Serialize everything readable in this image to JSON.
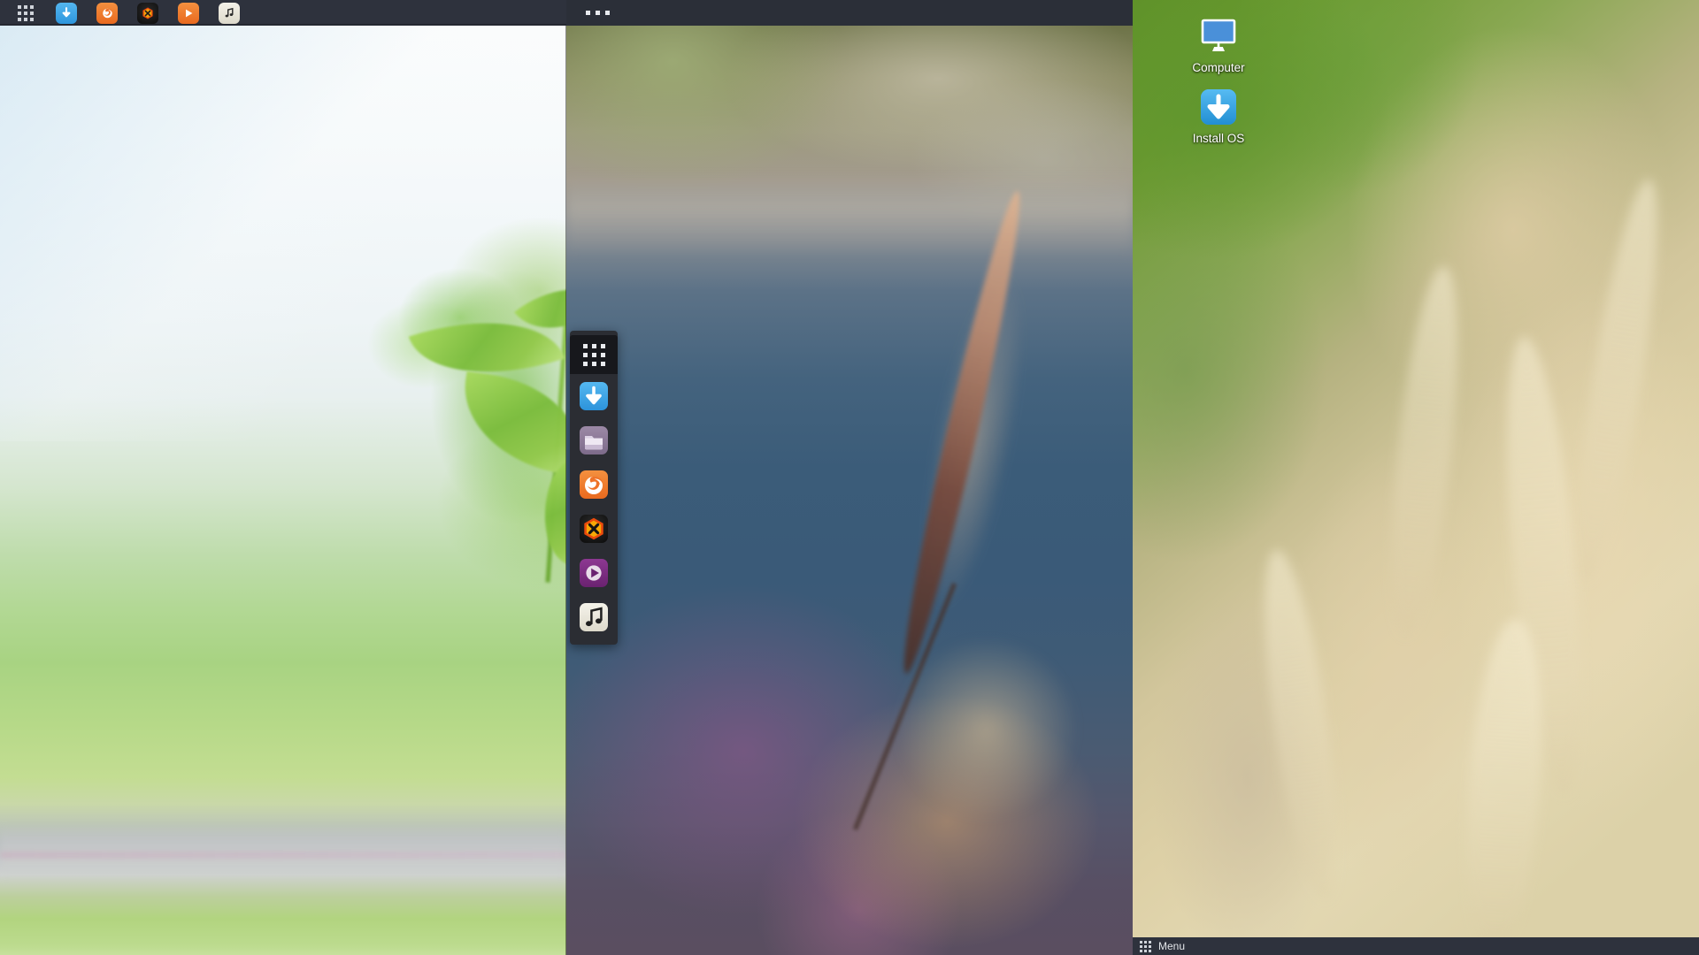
{
  "left_window": {
    "name": "Left Desktop Session",
    "topbar": {
      "launcher": {
        "icon": "grid-menu-icon",
        "label": "Applications"
      },
      "items": [
        {
          "id": "installer",
          "icon": "download-arrow-icon",
          "label": "Install OS",
          "color": "#3ea7e8"
        },
        {
          "id": "browser",
          "icon": "firefox-browser-icon",
          "label": "Web Browser",
          "color": "#ef7328"
        },
        {
          "id": "game",
          "icon": "hexagon-x-icon",
          "label": "Game",
          "color": "#17181c"
        },
        {
          "id": "video",
          "icon": "play-triangle-icon",
          "label": "Video Player",
          "color": "#ef7328"
        },
        {
          "id": "music",
          "icon": "music-note-icon",
          "label": "Music Player",
          "color": "#eeece3"
        }
      ]
    },
    "wallpaper": {
      "description": "Blurred green leaf over bright sky and meadow"
    }
  },
  "center_window": {
    "name": "Center Desktop Window",
    "titlebar": {
      "menu_icon": "three-dots-icon",
      "dots": 3
    },
    "wallpaper": {
      "description": "Blurred grass plume against a blue-grey road background"
    },
    "dock": {
      "name": "Application Dock",
      "launcher": {
        "icon": "grid-menu-icon",
        "label": "Show Applications"
      },
      "items": [
        {
          "id": "installer",
          "icon": "download-arrow-icon",
          "label": "Install OS",
          "color": "#3ea7e8"
        },
        {
          "id": "files",
          "icon": "folder-icon",
          "label": "File Manager",
          "color": "#8d7a96"
        },
        {
          "id": "browser",
          "icon": "firefox-browser-icon",
          "label": "Web Browser",
          "color": "#ef7328"
        },
        {
          "id": "game",
          "icon": "hexagon-x-icon",
          "label": "Game",
          "color": "#17181c"
        },
        {
          "id": "video",
          "icon": "play-triangle-icon",
          "label": "Video Player",
          "color": "#7b2d80"
        },
        {
          "id": "music",
          "icon": "music-note-icon",
          "label": "Music Player",
          "color": "#eeece3"
        }
      ]
    }
  },
  "right_desktop": {
    "name": "Right Desktop",
    "wallpaper": {
      "description": "Blurred wheat field with green grass"
    },
    "icons": [
      {
        "id": "computer",
        "icon": "monitor-icon",
        "label": "Computer",
        "color": "#4a90d9"
      },
      {
        "id": "install-os",
        "icon": "download-arrow-icon",
        "label": "Install OS",
        "color": "#3ea7e8"
      }
    ],
    "taskbar": {
      "menu": {
        "icon": "grid-menu-icon",
        "label": "Menu"
      }
    }
  },
  "theme": {
    "panel_bg": "#2e323d",
    "titlebar_bg": "#2b2f38",
    "dock_bg": "#2b2d33",
    "launcher_bg": "#17181c",
    "text": "#e3e6ea",
    "accent_blue": "#3ea7e8",
    "accent_orange": "#ef7328",
    "accent_purple": "#7b2d80"
  }
}
